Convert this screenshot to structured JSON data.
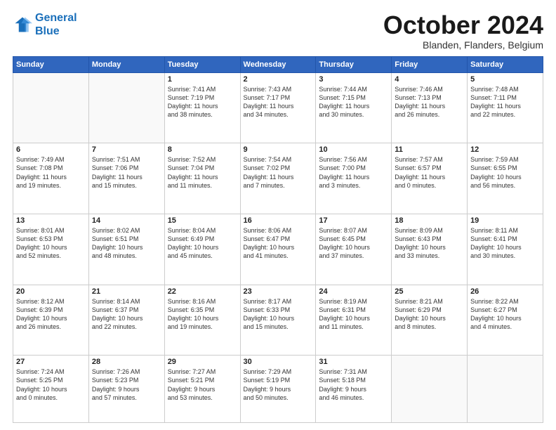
{
  "header": {
    "logo_line1": "General",
    "logo_line2": "Blue",
    "title": "October 2024",
    "location": "Blanden, Flanders, Belgium"
  },
  "weekdays": [
    "Sunday",
    "Monday",
    "Tuesday",
    "Wednesday",
    "Thursday",
    "Friday",
    "Saturday"
  ],
  "weeks": [
    [
      {
        "day": "",
        "text": ""
      },
      {
        "day": "",
        "text": ""
      },
      {
        "day": "1",
        "text": "Sunrise: 7:41 AM\nSunset: 7:19 PM\nDaylight: 11 hours\nand 38 minutes."
      },
      {
        "day": "2",
        "text": "Sunrise: 7:43 AM\nSunset: 7:17 PM\nDaylight: 11 hours\nand 34 minutes."
      },
      {
        "day": "3",
        "text": "Sunrise: 7:44 AM\nSunset: 7:15 PM\nDaylight: 11 hours\nand 30 minutes."
      },
      {
        "day": "4",
        "text": "Sunrise: 7:46 AM\nSunset: 7:13 PM\nDaylight: 11 hours\nand 26 minutes."
      },
      {
        "day": "5",
        "text": "Sunrise: 7:48 AM\nSunset: 7:11 PM\nDaylight: 11 hours\nand 22 minutes."
      }
    ],
    [
      {
        "day": "6",
        "text": "Sunrise: 7:49 AM\nSunset: 7:08 PM\nDaylight: 11 hours\nand 19 minutes."
      },
      {
        "day": "7",
        "text": "Sunrise: 7:51 AM\nSunset: 7:06 PM\nDaylight: 11 hours\nand 15 minutes."
      },
      {
        "day": "8",
        "text": "Sunrise: 7:52 AM\nSunset: 7:04 PM\nDaylight: 11 hours\nand 11 minutes."
      },
      {
        "day": "9",
        "text": "Sunrise: 7:54 AM\nSunset: 7:02 PM\nDaylight: 11 hours\nand 7 minutes."
      },
      {
        "day": "10",
        "text": "Sunrise: 7:56 AM\nSunset: 7:00 PM\nDaylight: 11 hours\nand 3 minutes."
      },
      {
        "day": "11",
        "text": "Sunrise: 7:57 AM\nSunset: 6:57 PM\nDaylight: 11 hours\nand 0 minutes."
      },
      {
        "day": "12",
        "text": "Sunrise: 7:59 AM\nSunset: 6:55 PM\nDaylight: 10 hours\nand 56 minutes."
      }
    ],
    [
      {
        "day": "13",
        "text": "Sunrise: 8:01 AM\nSunset: 6:53 PM\nDaylight: 10 hours\nand 52 minutes."
      },
      {
        "day": "14",
        "text": "Sunrise: 8:02 AM\nSunset: 6:51 PM\nDaylight: 10 hours\nand 48 minutes."
      },
      {
        "day": "15",
        "text": "Sunrise: 8:04 AM\nSunset: 6:49 PM\nDaylight: 10 hours\nand 45 minutes."
      },
      {
        "day": "16",
        "text": "Sunrise: 8:06 AM\nSunset: 6:47 PM\nDaylight: 10 hours\nand 41 minutes."
      },
      {
        "day": "17",
        "text": "Sunrise: 8:07 AM\nSunset: 6:45 PM\nDaylight: 10 hours\nand 37 minutes."
      },
      {
        "day": "18",
        "text": "Sunrise: 8:09 AM\nSunset: 6:43 PM\nDaylight: 10 hours\nand 33 minutes."
      },
      {
        "day": "19",
        "text": "Sunrise: 8:11 AM\nSunset: 6:41 PM\nDaylight: 10 hours\nand 30 minutes."
      }
    ],
    [
      {
        "day": "20",
        "text": "Sunrise: 8:12 AM\nSunset: 6:39 PM\nDaylight: 10 hours\nand 26 minutes."
      },
      {
        "day": "21",
        "text": "Sunrise: 8:14 AM\nSunset: 6:37 PM\nDaylight: 10 hours\nand 22 minutes."
      },
      {
        "day": "22",
        "text": "Sunrise: 8:16 AM\nSunset: 6:35 PM\nDaylight: 10 hours\nand 19 minutes."
      },
      {
        "day": "23",
        "text": "Sunrise: 8:17 AM\nSunset: 6:33 PM\nDaylight: 10 hours\nand 15 minutes."
      },
      {
        "day": "24",
        "text": "Sunrise: 8:19 AM\nSunset: 6:31 PM\nDaylight: 10 hours\nand 11 minutes."
      },
      {
        "day": "25",
        "text": "Sunrise: 8:21 AM\nSunset: 6:29 PM\nDaylight: 10 hours\nand 8 minutes."
      },
      {
        "day": "26",
        "text": "Sunrise: 8:22 AM\nSunset: 6:27 PM\nDaylight: 10 hours\nand 4 minutes."
      }
    ],
    [
      {
        "day": "27",
        "text": "Sunrise: 7:24 AM\nSunset: 5:25 PM\nDaylight: 10 hours\nand 0 minutes."
      },
      {
        "day": "28",
        "text": "Sunrise: 7:26 AM\nSunset: 5:23 PM\nDaylight: 9 hours\nand 57 minutes."
      },
      {
        "day": "29",
        "text": "Sunrise: 7:27 AM\nSunset: 5:21 PM\nDaylight: 9 hours\nand 53 minutes."
      },
      {
        "day": "30",
        "text": "Sunrise: 7:29 AM\nSunset: 5:19 PM\nDaylight: 9 hours\nand 50 minutes."
      },
      {
        "day": "31",
        "text": "Sunrise: 7:31 AM\nSunset: 5:18 PM\nDaylight: 9 hours\nand 46 minutes."
      },
      {
        "day": "",
        "text": ""
      },
      {
        "day": "",
        "text": ""
      }
    ]
  ]
}
